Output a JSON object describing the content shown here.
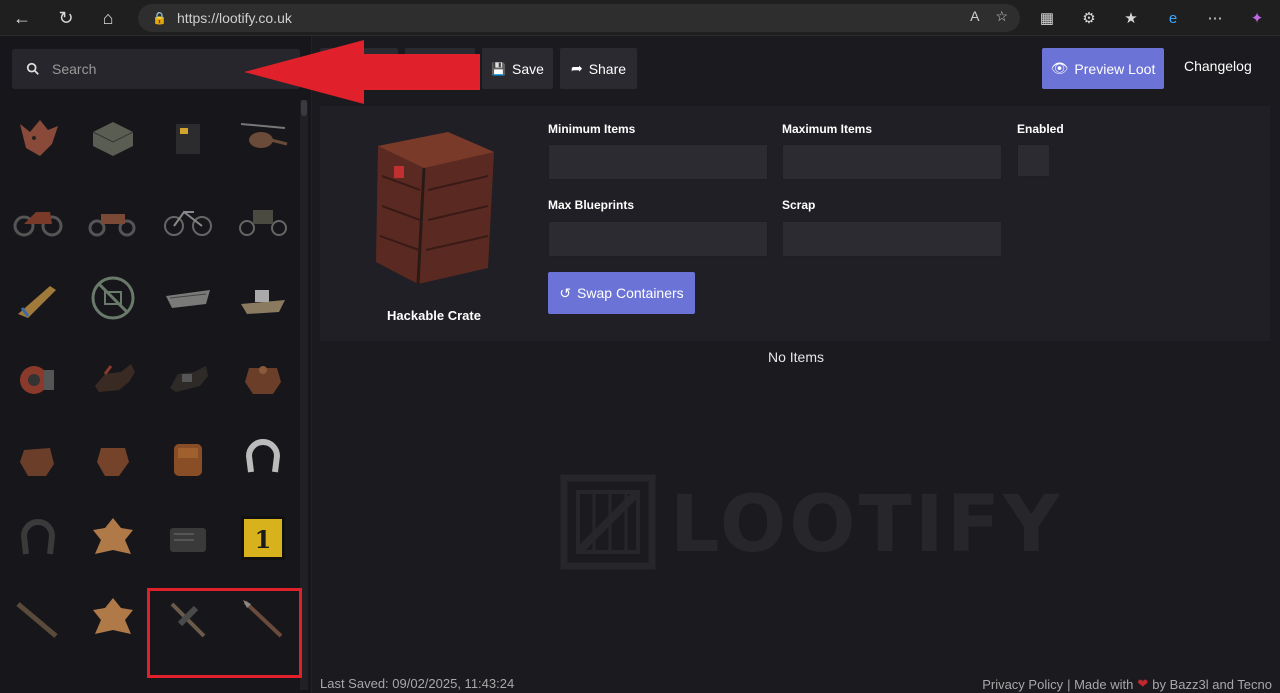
{
  "browser": {
    "url": "https://lootify.co.uk",
    "reader_label": "A"
  },
  "sidebar": {
    "search_placeholder": "Search",
    "items": [
      {
        "icon": "wolf-head-icon"
      },
      {
        "icon": "ammo-box-icon"
      },
      {
        "icon": "battery-icon"
      },
      {
        "icon": "helicopter-icon"
      },
      {
        "icon": "motorbike-icon"
      },
      {
        "icon": "motorbike-sidecar-icon"
      },
      {
        "icon": "bicycle-icon"
      },
      {
        "icon": "trike-icon"
      },
      {
        "icon": "rocket-icon"
      },
      {
        "icon": "no-image-icon"
      },
      {
        "icon": "rowboat-icon"
      },
      {
        "icon": "tugboat-icon"
      },
      {
        "icon": "engine-icon"
      },
      {
        "icon": "horse-icon"
      },
      {
        "icon": "horse-armor-icon"
      },
      {
        "icon": "saddle-icon"
      },
      {
        "icon": "saddle-double-icon"
      },
      {
        "icon": "saddle-single-icon"
      },
      {
        "icon": "saddlebag-icon"
      },
      {
        "icon": "horseshoe-icon"
      },
      {
        "icon": "horseshoe-dark-icon"
      },
      {
        "icon": "leather-icon"
      },
      {
        "icon": "radio-icon"
      },
      {
        "icon": "yellow-keycard-icon",
        "label": "1"
      },
      {
        "icon": "spear-icon"
      },
      {
        "icon": "hide-icon"
      },
      {
        "icon": "pickaxe-icon"
      },
      {
        "icon": "stone-spear-icon"
      }
    ]
  },
  "toolbar": {
    "save_label": "Save",
    "share_label": "Share",
    "preview_label": "Preview Loot",
    "changelog_label": "Changelog"
  },
  "container": {
    "name": "Hackable Crate",
    "fields": {
      "min_items": "Minimum Items",
      "max_items": "Maximum Items",
      "enabled": "Enabled",
      "max_blueprints": "Max Blueprints",
      "scrap": "Scrap"
    },
    "swap_label": "Swap Containers"
  },
  "empty_state": "No Items",
  "watermark": "LOOTIFY",
  "footer": {
    "last_saved": "Last Saved: 09/02/2025, 11:43:24",
    "privacy": "Privacy Policy",
    "made_with": "| Made with",
    "by": "by Bazz3l and Tecno"
  },
  "colors": {
    "accent": "#6b73d6",
    "highlight": "#e0202a",
    "background": "#1a1a1f"
  }
}
